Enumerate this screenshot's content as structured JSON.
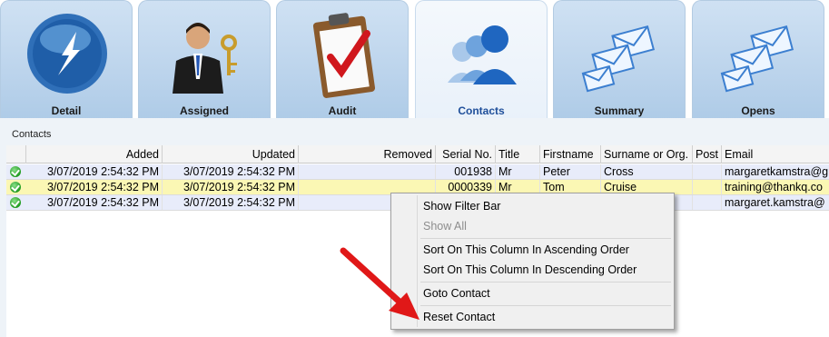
{
  "tabs": [
    {
      "label": "Detail",
      "icon": "lightning-globe-icon",
      "active": false
    },
    {
      "label": "Assigned",
      "icon": "businessman-key-icon",
      "active": false
    },
    {
      "label": "Audit",
      "icon": "clipboard-check-icon",
      "active": false
    },
    {
      "label": "Contacts",
      "icon": "people-group-icon",
      "active": true
    },
    {
      "label": "Summary",
      "icon": "envelopes-icon",
      "active": false
    },
    {
      "label": "Opens",
      "icon": "envelopes-icon",
      "active": false
    }
  ],
  "panel": {
    "caption": "Contacts"
  },
  "grid": {
    "columns": [
      "Added",
      "Updated",
      "Removed",
      "Serial No.",
      "Title",
      "Firstname",
      "Surname or Org.",
      "Post",
      "Email"
    ],
    "rows": [
      {
        "status": "check-icon",
        "added": "3/07/2019 2:54:32 PM",
        "updated": "3/07/2019 2:54:32 PM",
        "removed": "",
        "serial": "001938",
        "title": "Mr",
        "firstname": "Peter",
        "surname": "Cross",
        "post": "",
        "email": "margaretkamstra@g"
      },
      {
        "status": "check-icon",
        "added": "3/07/2019 2:54:32 PM",
        "updated": "3/07/2019 2:54:32 PM",
        "removed": "",
        "serial": "0000339",
        "title": "Mr",
        "firstname": "Tom",
        "surname": "Cruise",
        "post": "",
        "email": "training@thankq.co"
      },
      {
        "status": "check-icon",
        "added": "3/07/2019 2:54:32 PM",
        "updated": "3/07/2019 2:54:32 PM",
        "removed": "",
        "serial": "",
        "title": "",
        "firstname": "",
        "surname": "",
        "post": "",
        "email": "margaret.kamstra@"
      }
    ]
  },
  "context_menu": {
    "items": [
      {
        "label": "Show Filter Bar",
        "enabled": true
      },
      {
        "label": "Show All",
        "enabled": false
      },
      {
        "label": "Sort On This Column In Ascending Order",
        "enabled": true
      },
      {
        "label": "Sort On This Column In Descending Order",
        "enabled": true
      },
      {
        "label": "Goto Contact",
        "enabled": true
      },
      {
        "label": "Reset Contact",
        "enabled": true
      }
    ]
  },
  "colors": {
    "annotation_arrow": "#e01818",
    "highlight_row": "#fbf7b4",
    "active_tab_text": "#1f4f9a"
  }
}
